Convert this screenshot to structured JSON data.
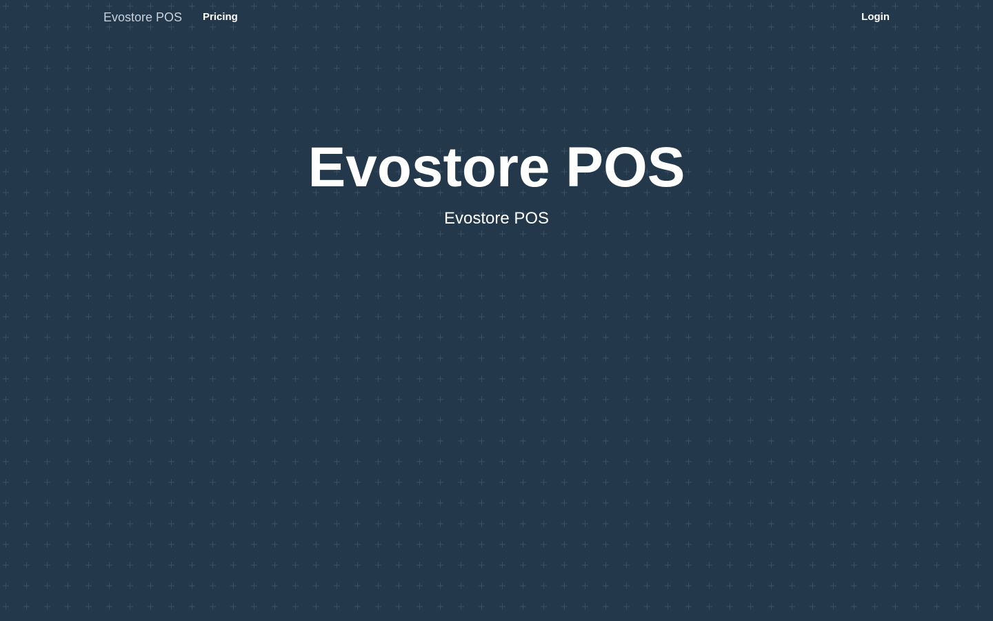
{
  "nav": {
    "brand": "Evostore POS",
    "pricing_label": "Pricing",
    "login_label": "Login"
  },
  "hero": {
    "title": "Evostore POS",
    "subtitle": "Evostore POS"
  },
  "colors": {
    "background": "#24384b",
    "pattern": "#3a4f63",
    "brand_text": "#c9d2dc",
    "text": "#ffffff"
  },
  "background_pattern": "plus-grid"
}
